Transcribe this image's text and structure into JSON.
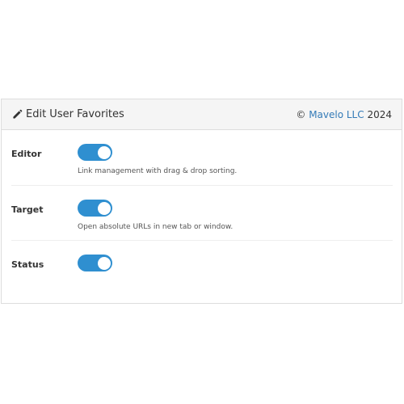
{
  "header": {
    "title": "Edit User Favorites",
    "icon": "pencil-icon",
    "copyright_symbol": "©",
    "company": "Mavelo LLC",
    "year": "2024",
    "link_color": "#337ab7"
  },
  "settings": [
    {
      "label": "Editor",
      "enabled": true,
      "description": "Link management with drag & drop sorting."
    },
    {
      "label": "Target",
      "enabled": true,
      "description": "Open absolute URLs in new tab or window."
    },
    {
      "label": "Status",
      "enabled": true,
      "description": ""
    }
  ],
  "colors": {
    "toggle_on": "#2f8fd0",
    "header_bg": "#f5f5f5"
  }
}
